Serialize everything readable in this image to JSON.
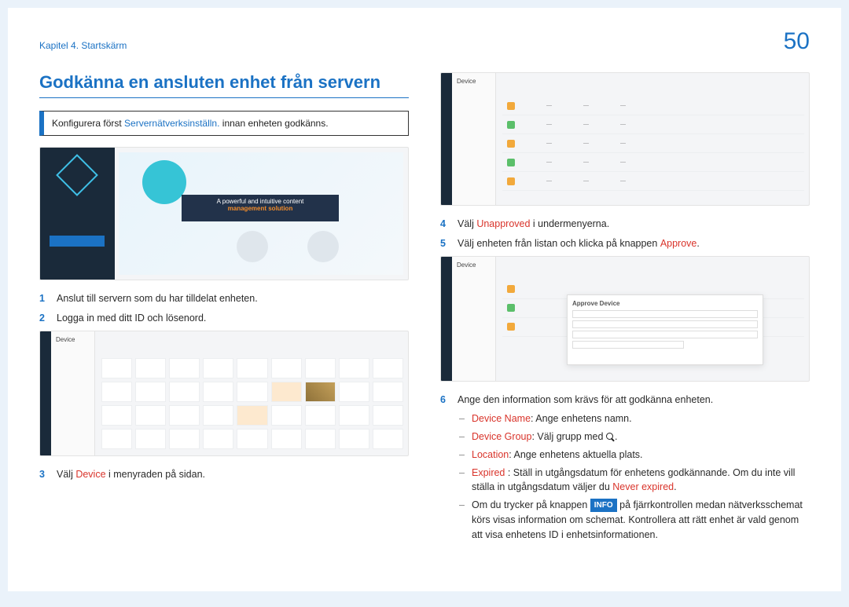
{
  "chapter": "Kapitel 4. Startskärm",
  "page_number": "50",
  "heading": "Godkänna en ansluten enhet från servern",
  "note": {
    "pre": "Konfigurera först ",
    "link": "Servernätverksinställn.",
    "post": " innan enheten godkänns."
  },
  "banner": {
    "line1": "A powerful and intuitive content",
    "line2": "management solution"
  },
  "steps": {
    "s1": {
      "num": "1",
      "text": "Anslut till servern som du har tilldelat enheten."
    },
    "s2": {
      "num": "2",
      "text": "Logga in med ditt ID och lösenord."
    },
    "s3": {
      "num": "3",
      "pre": "Välj ",
      "hl": "Device",
      "post": " i menyraden på sidan."
    },
    "s4": {
      "num": "4",
      "pre": "Välj ",
      "hl": "Unapproved",
      "post": " i undermenyerna."
    },
    "s5": {
      "num": "5",
      "pre": "Välj enheten från listan och klicka på knappen ",
      "hl": "Approve",
      "post": "."
    },
    "s6": {
      "num": "6",
      "text": "Ange den information som krävs för att godkänna enheten."
    }
  },
  "subs": {
    "a": {
      "hl": "Device Name",
      "text": ": Ange enhetens namn."
    },
    "b": {
      "hl": "Device Group",
      "pre": ": Välj grupp med ",
      "post": "."
    },
    "c": {
      "hl": "Location",
      "text": ": Ange enhetens aktuella plats."
    },
    "d": {
      "hl": "Expired",
      "pre": " : Ställ in utgångsdatum för enhetens godkännande. Om du inte vill ställa in utgångsdatum väljer du ",
      "hl2": "Never expired",
      "post": "."
    },
    "e": {
      "pre": "Om du trycker på knappen ",
      "badge": "INFO",
      "post": " på fjärrkontrollen medan nätverksschemat körs visas information om schemat. Kontrollera att rätt enhet är vald genom att visa enhetens ID i enhetsinformationen."
    }
  },
  "ss_labels": {
    "device": "Device",
    "approve_dialog": "Approve Device"
  }
}
